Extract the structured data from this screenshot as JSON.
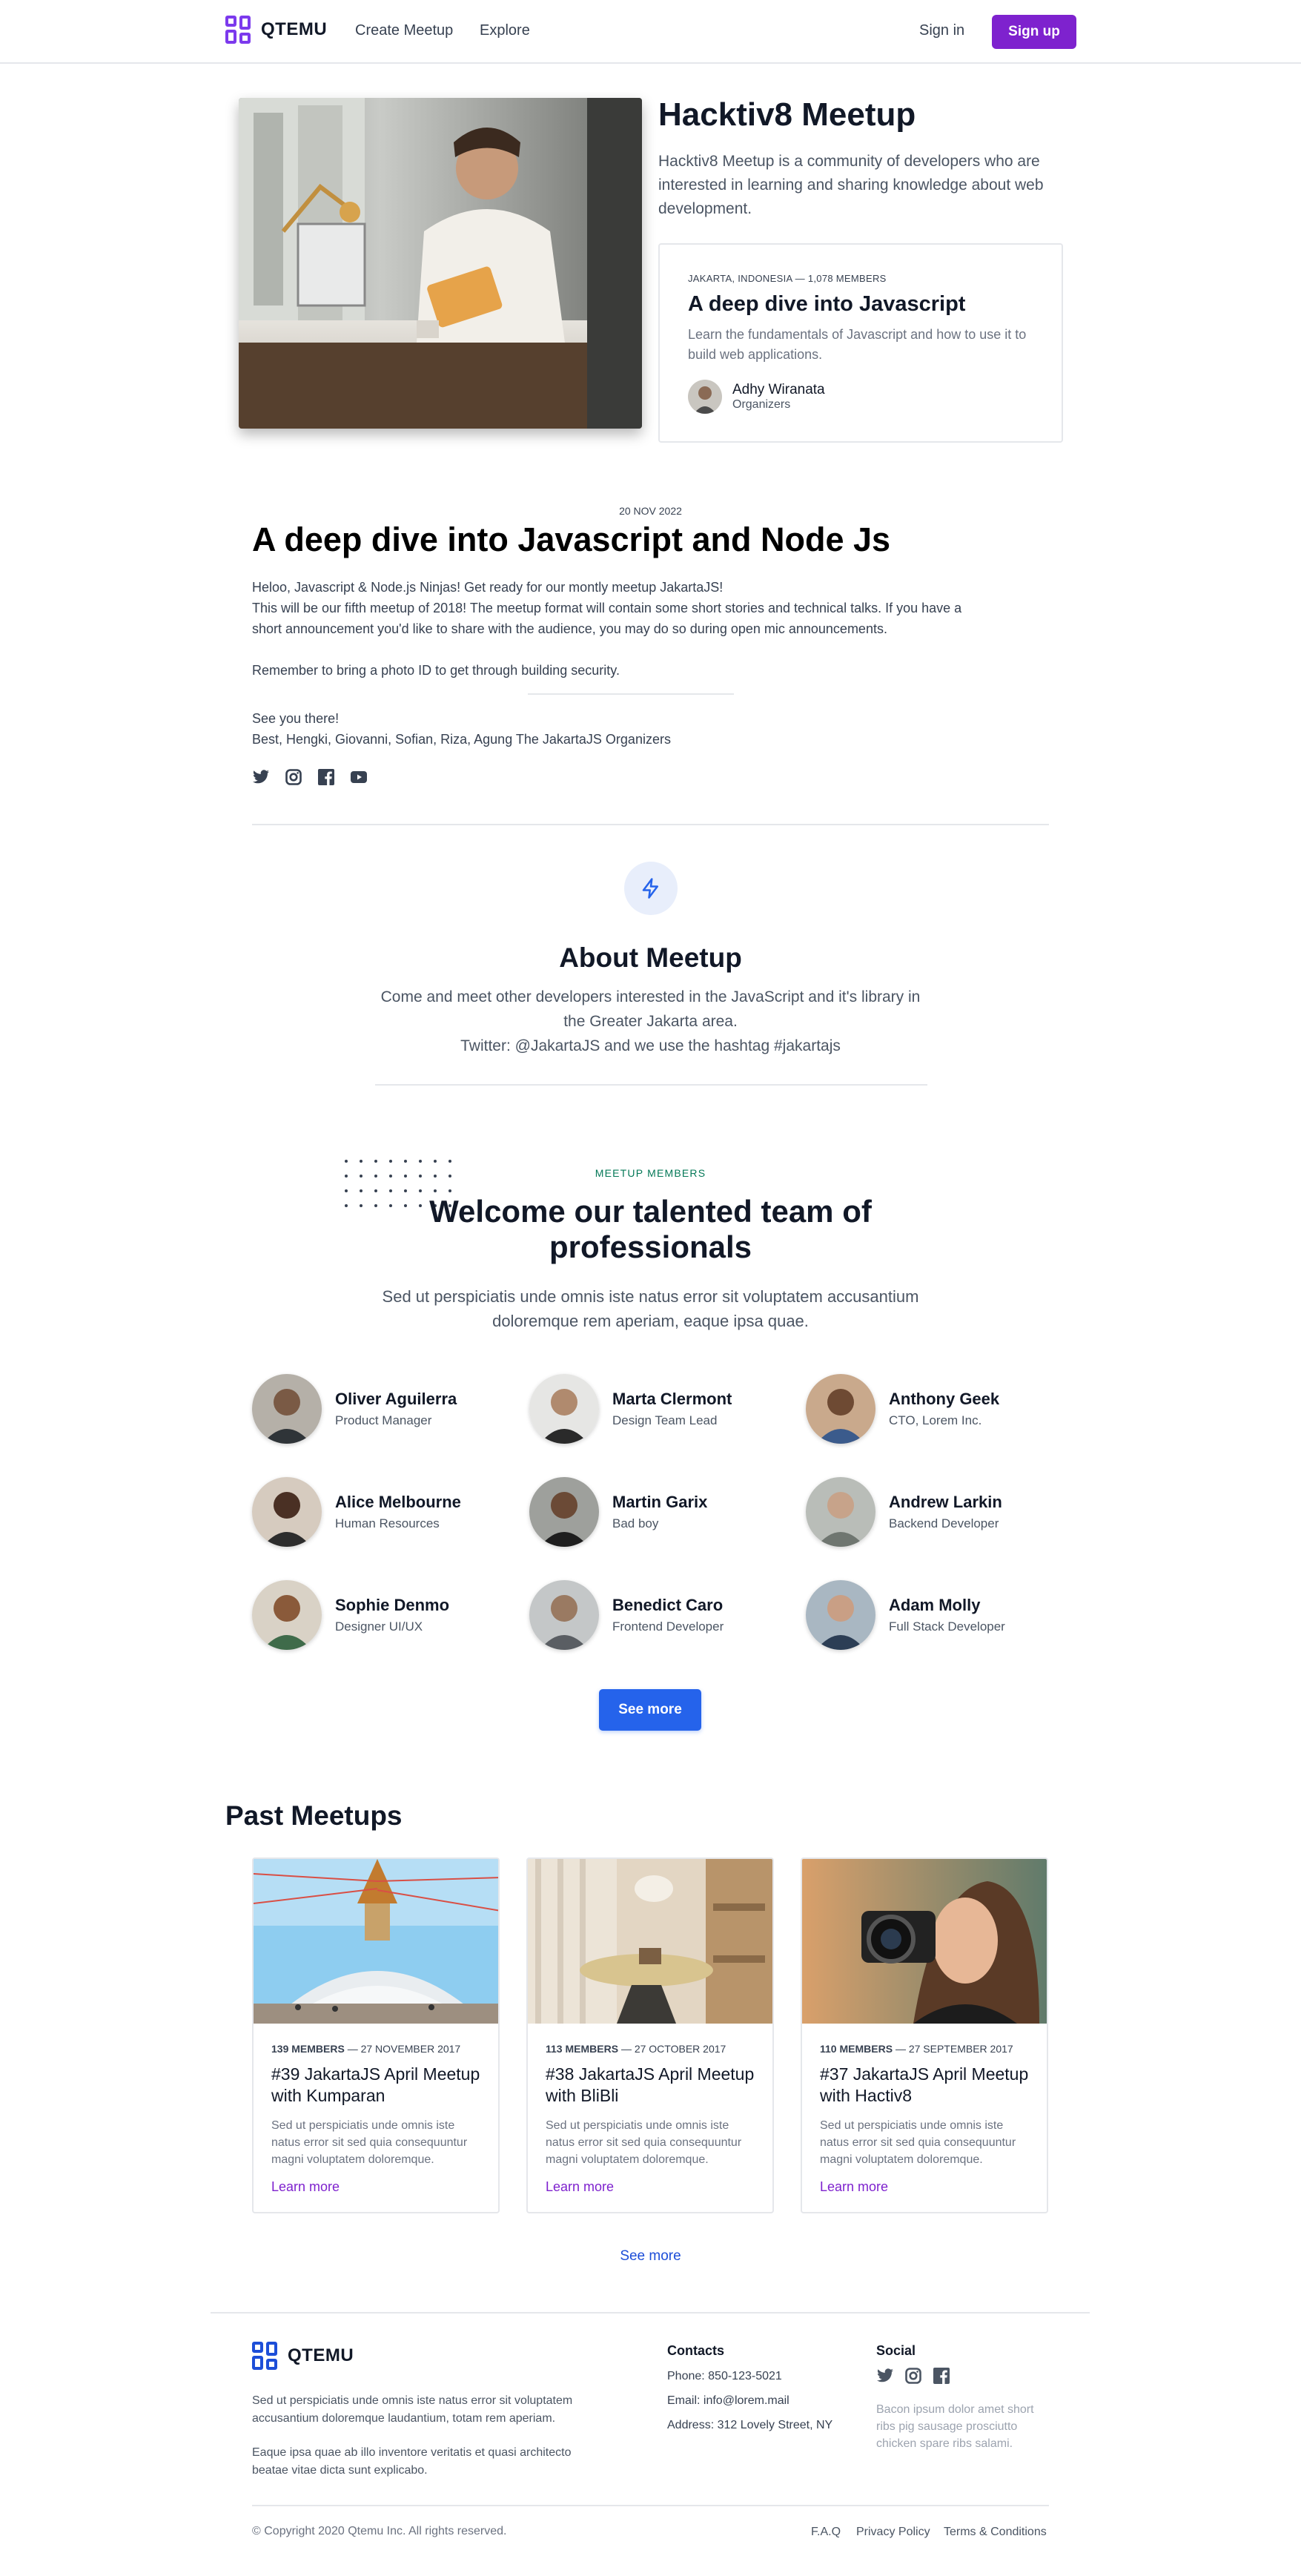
{
  "nav": {
    "brand": "QTEMU",
    "links": [
      "Create Meetup",
      "Explore"
    ],
    "signin": "Sign in",
    "signup": "Sign up"
  },
  "hero": {
    "title": "Hacktiv8 Meetup",
    "description": "Hacktiv8 Meetup is a community of developers who are interested in learning and sharing knowledge about web development.",
    "card": {
      "meta": "JAKARTA, INDONESIA — 1,078 MEMBERS",
      "title": "A deep dive into Javascript",
      "description": "Learn the fundamentals of Javascript and how to use it to build web applications.",
      "organizer_name": "Adhy Wiranata",
      "organizer_role": "Organizers"
    }
  },
  "article": {
    "date": "20 NOV 2022",
    "title": "A deep dive into Javascript and Node Js",
    "line1": "Heloo, Javascript & Node.js Ninjas! Get ready for our montly meetup JakartaJS!",
    "line2": "This will be our fifth meetup of 2018! The meetup format will contain some short stories and technical talks. If you have a short announcement you'd like to share with the audience, you may do so during open mic announcements.",
    "line3": "Remember to bring a photo ID to get through building security.",
    "sign1": "See you there!",
    "sign2": "Best, Hengki, Giovanni, Sofian, Riza, Agung The JakartaJS Organizers",
    "socials": [
      "twitter-icon",
      "instagram-icon",
      "facebook-icon",
      "youtube-icon"
    ]
  },
  "about": {
    "title": "About Meetup",
    "line1": "Come and meet other developers interested in the JavaScript and it's library in the Greater Jakarta area.",
    "line2": "Twitter: @JakartaJS and we use the hashtag #jakartajs"
  },
  "team": {
    "label": "MEETUP MEMBERS",
    "title": "Welcome our talented team of professionals",
    "subtitle": "Sed ut perspiciatis unde omnis iste natus error sit voluptatem accusantium doloremque rem aperiam, eaque ipsa quae.",
    "members": [
      {
        "name": "Oliver Aguilerra",
        "role": "Product Manager"
      },
      {
        "name": "Marta Clermont",
        "role": "Design Team Lead"
      },
      {
        "name": "Anthony Geek",
        "role": "CTO, Lorem Inc."
      },
      {
        "name": "Alice Melbourne",
        "role": "Human Resources"
      },
      {
        "name": "Martin Garix",
        "role": "Bad boy"
      },
      {
        "name": "Andrew Larkin",
        "role": "Backend Developer"
      },
      {
        "name": "Sophie Denmo",
        "role": "Designer UI/UX"
      },
      {
        "name": "Benedict Caro",
        "role": "Frontend Developer"
      },
      {
        "name": "Adam Molly",
        "role": "Full Stack Developer"
      }
    ],
    "see_more": "See more"
  },
  "past": {
    "title": "Past Meetups",
    "cards": [
      {
        "members": "139 MEMBERS",
        "date": "— 27 NOVEMBER 2017",
        "title": "#39 JakartaJS April Meetup with Kumparan",
        "desc": "Sed ut perspiciatis unde omnis iste natus error sit sed quia consequuntur magni voluptatem doloremque.",
        "link": "Learn more"
      },
      {
        "members": "113 MEMBERS",
        "date": "— 27 OCTOBER 2017",
        "title": "#38 JakartaJS April Meetup with BliBli",
        "desc": "Sed ut perspiciatis unde omnis iste natus error sit sed quia consequuntur magni voluptatem doloremque.",
        "link": "Learn more"
      },
      {
        "members": "110 MEMBERS",
        "date": "— 27 SEPTEMBER 2017",
        "title": "#37 JakartaJS April Meetup with Hactiv8",
        "desc": "Sed ut perspiciatis unde omnis iste natus error sit sed quia consequuntur magni voluptatem doloremque.",
        "link": "Learn more"
      }
    ],
    "see_more": "See more"
  },
  "footer": {
    "brand": "QTEMU",
    "desc1": "Sed ut perspiciatis unde omnis iste natus error sit voluptatem accusantium doloremque laudantium, totam rem aperiam.",
    "desc2": "Eaque ipsa quae ab illo inventore veritatis et quasi architecto beatae vitae dicta sunt explicabo.",
    "contacts_head": "Contacts",
    "phone": "Phone: 850-123-5021",
    "email": "Email: info@lorem.mail",
    "address": "Address: 312 Lovely Street, NY",
    "social_head": "Social",
    "social_text": "Bacon ipsum dolor amet short ribs pig sausage prosciutto chicken spare ribs salami.",
    "copyright": "© Copyright 2020 Qtemu Inc. All rights reserved.",
    "links": [
      "F.A.Q",
      "Privacy Policy",
      "Terms & Conditions"
    ]
  },
  "colors": {
    "brand_purple": "#7e22ce",
    "primary_blue": "#2563eb",
    "label_green": "#047857"
  }
}
